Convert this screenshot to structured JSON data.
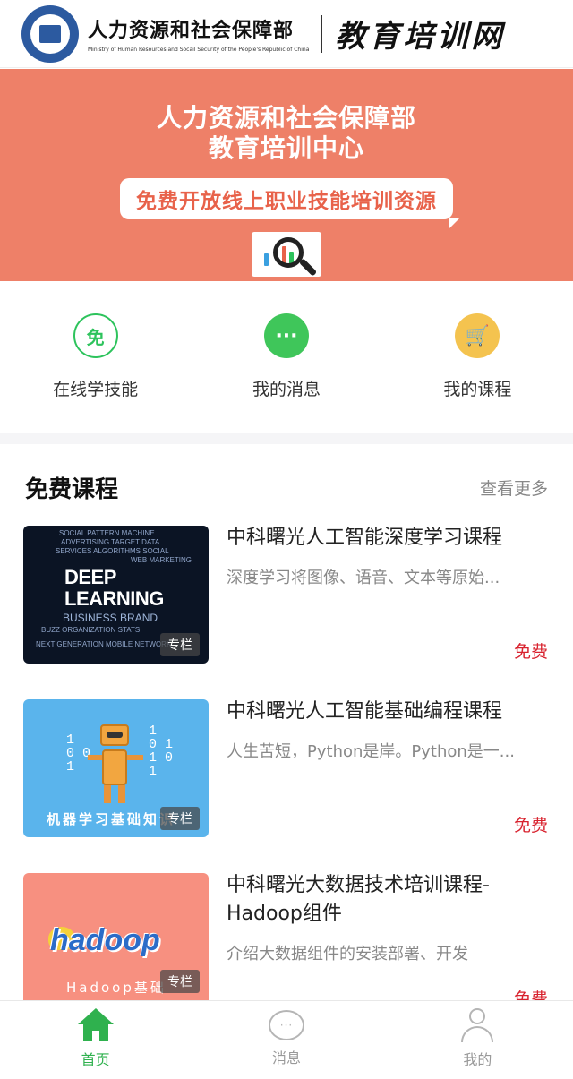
{
  "header": {
    "org_name": "人力资源和社会保障部",
    "org_subtitle": "Ministry of Human Resources and Socail Security of the People's Republic of China",
    "brand_title": "教育培训网"
  },
  "banner": {
    "line1": "人力资源和社会保障部",
    "line2": "教育培训中心",
    "tagline": "免费开放线上职业技能培训资源",
    "background": "#ee8068"
  },
  "quick_nav": [
    {
      "label": "在线学技能",
      "icon": "free-badge-icon",
      "glyph": "免"
    },
    {
      "label": "我的消息",
      "icon": "chat-bubble-icon",
      "glyph": "···"
    },
    {
      "label": "我的课程",
      "icon": "cart-icon",
      "glyph": "🛒"
    }
  ],
  "courses_section": {
    "title": "免费课程",
    "more_label": "查看更多",
    "items": [
      {
        "title": "中科曙光人工智能深度学习课程",
        "description": "深度学习将图像、语音、文本等原始...",
        "tag": "专栏",
        "price": "免费",
        "thumb_text": "DEEP LEARNING"
      },
      {
        "title": "中科曙光人工智能基础编程课程",
        "description": "人生苦短，Python是岸。Python是一...",
        "tag": "专栏",
        "price": "免费",
        "thumb_text": "机器学习基础知识"
      },
      {
        "title": "中科曙光大数据技术培训课程-Hadoop组件",
        "description": "介绍大数据组件的安装部署、开发",
        "tag": "专栏",
        "price": "免费",
        "thumb_text": "hadoop",
        "thumb_caption": "Hadoop基础"
      }
    ]
  },
  "tabbar": {
    "items": [
      {
        "label": "首页",
        "icon": "home-icon",
        "active": true
      },
      {
        "label": "消息",
        "icon": "chat-icon",
        "active": false
      },
      {
        "label": "我的",
        "icon": "user-icon",
        "active": false
      }
    ],
    "active_color": "#2fb14e"
  },
  "colors": {
    "accent_green": "#2fb14e",
    "price_red": "#d8222e"
  }
}
